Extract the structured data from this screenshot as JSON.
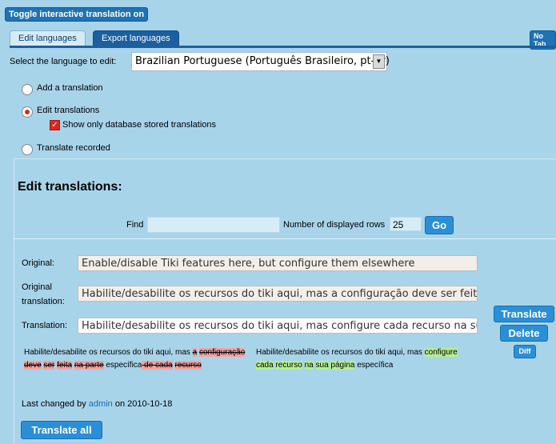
{
  "toolbar": {
    "toggle_label": "Toggle interactive translation on",
    "no_tabs_label": "No Tab"
  },
  "tabs": [
    {
      "label": "Edit languages",
      "active": true
    },
    {
      "label": "Export languages",
      "active": false
    }
  ],
  "language_select": {
    "label": "Select the language to edit:",
    "value": "Brazilian Portuguese (Português Brasileiro, pt-br)"
  },
  "mode_options": [
    {
      "label": "Add a translation",
      "selected": false
    },
    {
      "label": "Edit translations",
      "selected": true
    },
    {
      "label": "Translate recorded",
      "selected": false
    }
  ],
  "show_db_checkbox": {
    "label": "Show only database stored translations",
    "checked": true
  },
  "panel": {
    "title": "Edit translations:",
    "find_label": "Find",
    "find_value": "",
    "rows_label": "Number of displayed rows",
    "rows_value": "25",
    "go_label": "Go"
  },
  "entry": {
    "original_label": "Original:",
    "original_value": "Enable/disable Tiki features here, but configure them elsewhere",
    "orig_translation_label_1": "Original",
    "orig_translation_label_2": "translation:",
    "orig_translation_value": "Habilite/desabilite os recursos do tiki aqui, mas a configuração deve ser feita na pa",
    "translation_label": "Translation:",
    "translation_value": "Habilite/desabilite os recursos do tiki aqui, mas configure cada recurso na sua pági",
    "translate_button": "Translate",
    "delete_button": "Delete",
    "diff_button": "Diff"
  },
  "diff_left": [
    {
      "t": "Habilite/desabilite os recursos do tiki aqui, mas ",
      "k": "plain"
    },
    {
      "t": "a",
      "k": "del"
    },
    {
      "t": " ",
      "k": "plain"
    },
    {
      "t": "configuração",
      "k": "del"
    },
    {
      "t": " ",
      "k": "plain"
    },
    {
      "t": "deve",
      "k": "del"
    },
    {
      "t": " ",
      "k": "plain"
    },
    {
      "t": "ser",
      "k": "del"
    },
    {
      "t": " ",
      "k": "plain"
    },
    {
      "t": "feita",
      "k": "del"
    },
    {
      "t": " ",
      "k": "plain"
    },
    {
      "t": "na parte",
      "k": "del"
    },
    {
      "t": " específica",
      "k": "plain"
    },
    {
      "t": " de cada",
      "k": "del"
    },
    {
      "t": " ",
      "k": "plain"
    },
    {
      "t": "recurso",
      "k": "del"
    }
  ],
  "diff_right": [
    {
      "t": "Habilite/desabilite os recursos do tiki aqui, mas ",
      "k": "plain"
    },
    {
      "t": "configure",
      "k": "ins"
    },
    {
      "t": " ",
      "k": "plain"
    },
    {
      "t": "cada",
      "k": "ins"
    },
    {
      "t": " ",
      "k": "plain"
    },
    {
      "t": "recurso",
      "k": "ins"
    },
    {
      "t": " ",
      "k": "plain"
    },
    {
      "t": "na",
      "k": "ins"
    },
    {
      "t": " ",
      "k": "plain"
    },
    {
      "t": "sua",
      "k": "ins"
    },
    {
      "t": " ",
      "k": "plain"
    },
    {
      "t": "página",
      "k": "ins"
    },
    {
      "t": " específica",
      "k": "plain"
    }
  ],
  "last_changed": {
    "prefix": "Last changed by ",
    "user": "admin",
    "middle": " on ",
    "date": "2010-10-18"
  },
  "translate_all_label": "Translate all",
  "colors": {
    "background": "#a8d4ea",
    "button": "#2a8fd6",
    "deleted": "#f2a3a3",
    "inserted": "#b5ee90"
  }
}
